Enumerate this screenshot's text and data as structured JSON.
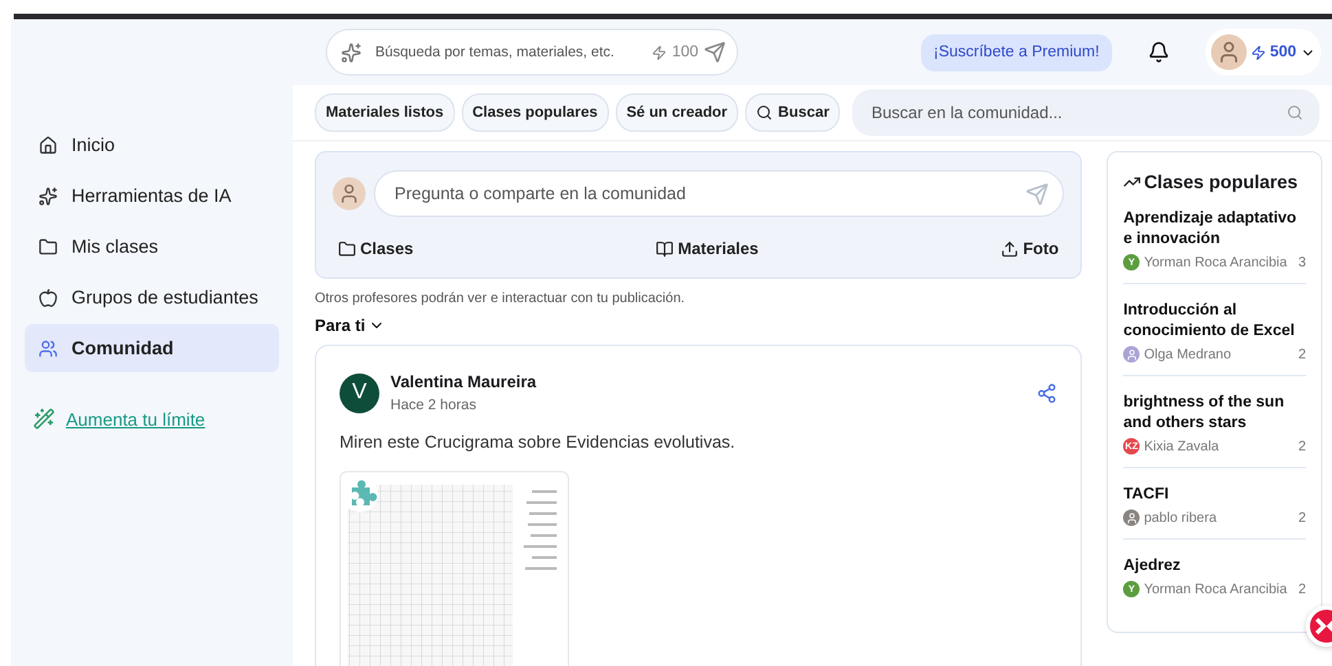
{
  "search": {
    "placeholder": "Búsqueda por temas, materiales, etc.",
    "credits": "100"
  },
  "premium_button": "¡Suscríbete a Premium!",
  "user": {
    "credits": "500"
  },
  "sidebar": {
    "items": [
      {
        "label": "Inicio",
        "selected": false
      },
      {
        "label": "Herramientas de IA",
        "selected": false
      },
      {
        "label": "Mis clases",
        "selected": false
      },
      {
        "label": "Grupos de estudiantes",
        "selected": false
      },
      {
        "label": "Comunidad",
        "selected": true
      }
    ],
    "upgrade_link": "Aumenta tu límite"
  },
  "filters": [
    {
      "label": "Materiales listos",
      "kind": "chip"
    },
    {
      "label": "Clases populares",
      "kind": "chip"
    },
    {
      "label": "Sé un creador",
      "kind": "chip"
    },
    {
      "label": "Buscar",
      "kind": "search"
    }
  ],
  "community_search": {
    "placeholder": "Buscar en la comunidad..."
  },
  "composer": {
    "placeholder": "Pregunta o comparte en la comunidad",
    "actions": [
      {
        "label": "Clases"
      },
      {
        "label": "Materiales"
      },
      {
        "label": "Foto"
      }
    ],
    "note": "Otros profesores podrán ver e interactuar con tu publicación."
  },
  "feed_filter": "Para ti",
  "post": {
    "initial": "V",
    "author": "Valentina Maureira",
    "time": "Hace 2 horas",
    "text": "Miren este Crucigrama sobre Evidencias evolutivas."
  },
  "popular": {
    "title": "Clases populares",
    "items": [
      {
        "title": "Aprendizaje adaptativo e innovación",
        "author": "Yorman Roca Arancibia",
        "count": "3",
        "avatar": {
          "kind": "initial",
          "text": "Y",
          "color": "#5c9e3f"
        }
      },
      {
        "title": "Introducción al conocimiento de Excel",
        "author": "Olga Medrano",
        "count": "2"
      },
      {
        "title": "brightness of the sun and others stars",
        "author": "Kixia Zavala",
        "count": "2",
        "avatar": {
          "kind": "initial",
          "text": "KZ",
          "color": "#e5484d"
        }
      },
      {
        "title": "TACFI",
        "author": "pablo ribera",
        "count": "2"
      },
      {
        "title": "Ajedrez",
        "author": "Yorman Roca Arancibia",
        "count": "2",
        "avatar": {
          "kind": "initial",
          "text": "Y",
          "color": "#5c9e3f"
        }
      }
    ]
  }
}
